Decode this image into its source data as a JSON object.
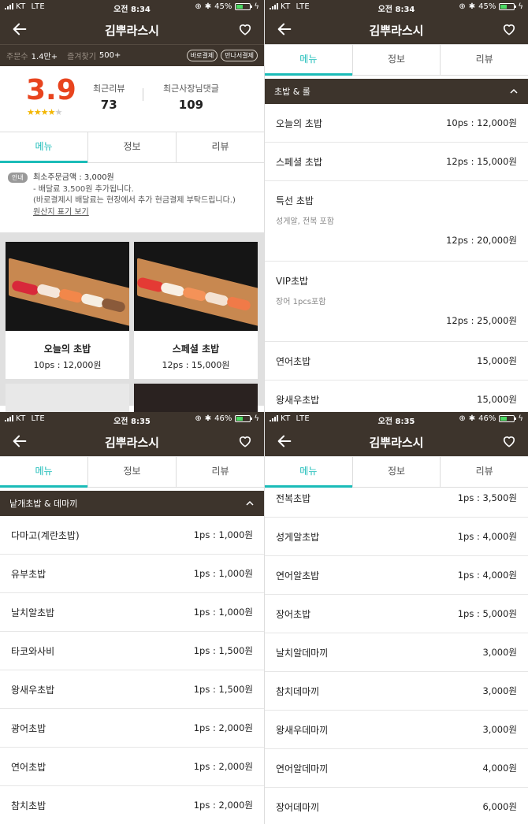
{
  "status_bars": [
    {
      "carrier": "KT",
      "network": "LTE",
      "time": "오전 8:34",
      "battery": "45%",
      "battery_level": 0.45
    },
    {
      "carrier": "KT",
      "network": "LTE",
      "time": "오전 8:34",
      "battery": "45%",
      "battery_level": 0.45
    },
    {
      "carrier": "KT",
      "network": "LTE",
      "time": "오전 8:35",
      "battery": "46%",
      "battery_level": 0.46
    },
    {
      "carrier": "KT",
      "network": "LTE",
      "time": "오전 8:35",
      "battery": "46%",
      "battery_level": 0.46
    }
  ],
  "app": {
    "title": "김뿌라스시",
    "back_icon": "back-arrow-icon",
    "favorite_icon": "heart-icon"
  },
  "store_stats": {
    "orders_label": "주문수",
    "orders_value": "1.4만+",
    "favorites_label": "즐겨찾기",
    "favorites_value": "500+",
    "badges": [
      "바로결제",
      "만나서결제"
    ]
  },
  "rating": {
    "score": "3.9",
    "stars": 4,
    "recent_reviews_label": "최근리뷰",
    "recent_reviews_value": "73",
    "owner_comments_label": "최근사장님댓글",
    "owner_comments_value": "109"
  },
  "tabs": [
    "메뉴",
    "정보",
    "리뷰"
  ],
  "active_tab": 0,
  "notice": {
    "tag": "안내",
    "min_order": "최소주문금액 : 3,000원",
    "delivery_fee": "- 배달료 3,500원 추가됩니다.",
    "payment_note": "(바로결제시 배달료는 현장에서 추가 현금결제 부탁드립니다.)",
    "origin_link": "원산지 표기 보기"
  },
  "featured": [
    {
      "name": "오늘의 초밥",
      "price": "10ps : 12,000원"
    },
    {
      "name": "스페셜 초밥",
      "price": "12ps : 15,000원"
    }
  ],
  "section_chobap_roll": {
    "title": "초밥 & 롤",
    "items": [
      {
        "name": "오늘의 초밥",
        "desc": "",
        "price": "10ps : 12,000원"
      },
      {
        "name": "스페셜 초밥",
        "desc": "",
        "price": "12ps : 15,000원"
      },
      {
        "name": "특선 초밥",
        "desc": "성게알, 전복 포함",
        "price": "12ps : 20,000원"
      },
      {
        "name": "VIP초밥",
        "desc": "장어 1pcs포함",
        "price": "12ps : 25,000원"
      },
      {
        "name": "연어초밥",
        "desc": "",
        "price": "15,000원"
      },
      {
        "name": "왕새우초밥",
        "desc": "",
        "price": "15,000원"
      }
    ]
  },
  "section_single": {
    "title": "낱개초밥 & 데마끼",
    "items": [
      {
        "name": "다마고(계란초밥)",
        "price": "1ps : 1,000원"
      },
      {
        "name": "유부초밥",
        "price": "1ps : 1,000원"
      },
      {
        "name": "날치알초밥",
        "price": "1ps : 1,000원"
      },
      {
        "name": "타코와사비",
        "price": "1ps : 1,500원"
      },
      {
        "name": "왕새우초밥",
        "price": "1ps : 1,500원"
      },
      {
        "name": "광어초밥",
        "price": "1ps : 2,000원"
      },
      {
        "name": "연어초밥",
        "price": "1ps : 2,000원"
      },
      {
        "name": "참치초밥",
        "price": "1ps : 2,000원"
      }
    ]
  },
  "section_single_continued": {
    "items": [
      {
        "name": "전복초밥",
        "price": "1ps : 3,500원"
      },
      {
        "name": "성게알초밥",
        "price": "1ps : 4,000원"
      },
      {
        "name": "연어알초밥",
        "price": "1ps : 4,000원"
      },
      {
        "name": "장어초밥",
        "price": "1ps : 5,000원"
      },
      {
        "name": "날치알데마끼",
        "price": "3,000원"
      },
      {
        "name": "참치데마끼",
        "price": "3,000원"
      },
      {
        "name": "왕새우데마끼",
        "price": "3,000원"
      },
      {
        "name": "연어알데마끼",
        "price": "4,000원"
      },
      {
        "name": "장어데마끼",
        "price": "6,000원"
      }
    ]
  }
}
